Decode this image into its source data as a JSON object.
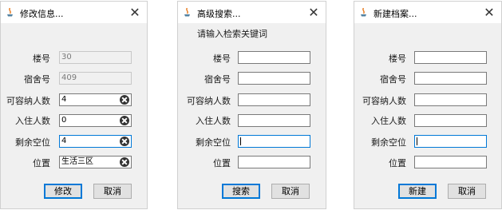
{
  "dialogs": {
    "edit": {
      "title": "修改信息...",
      "fields": [
        {
          "label": "楼号",
          "value": "30"
        },
        {
          "label": "宿舍号",
          "value": "409"
        },
        {
          "label": "可容纳人数",
          "value": "4"
        },
        {
          "label": "入住人数",
          "value": "0"
        },
        {
          "label": "剩余空位",
          "value": "4"
        },
        {
          "label": "位置",
          "value": "生活三区"
        }
      ],
      "buttons": {
        "primary": "修改",
        "cancel": "取消"
      }
    },
    "search": {
      "title": "高级搜索...",
      "prompt": "请输入检索关键词",
      "fields": [
        {
          "label": "楼号",
          "value": ""
        },
        {
          "label": "宿舍号",
          "value": ""
        },
        {
          "label": "可容纳人数",
          "value": ""
        },
        {
          "label": "入住人数",
          "value": ""
        },
        {
          "label": "剩余空位",
          "value": ""
        },
        {
          "label": "位置",
          "value": ""
        }
      ],
      "buttons": {
        "primary": "搜索",
        "cancel": "取消"
      }
    },
    "new": {
      "title": "新建档案...",
      "fields": [
        {
          "label": "楼号",
          "value": ""
        },
        {
          "label": "宿舍号",
          "value": ""
        },
        {
          "label": "可容纳人数",
          "value": ""
        },
        {
          "label": "入住人数",
          "value": ""
        },
        {
          "label": "剩余空位",
          "value": ""
        },
        {
          "label": "位置",
          "value": ""
        }
      ],
      "buttons": {
        "primary": "新建",
        "cancel": "取消"
      }
    }
  },
  "icons": {
    "app": "java-cup-icon",
    "close": "close-icon",
    "clear": "clear-field-icon"
  },
  "colors": {
    "focus_border": "#0078d7",
    "dialog_bg": "#f0f0f0",
    "titlebar_bg": "#ffffff"
  }
}
